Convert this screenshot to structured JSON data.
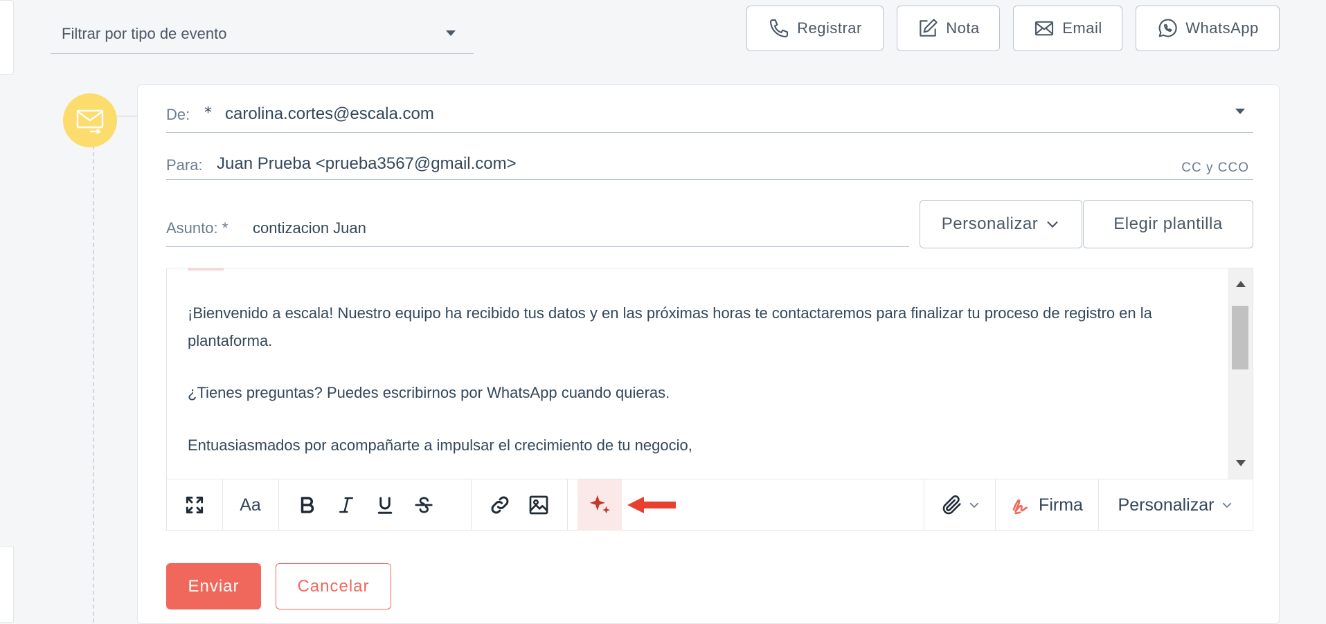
{
  "filter": {
    "label": "Filtrar por tipo de evento"
  },
  "actions": {
    "registrar": "Registrar",
    "nota": "Nota",
    "email": "Email",
    "whatsapp": "WhatsApp"
  },
  "email_form": {
    "from_label": "De:",
    "required_mark": "*",
    "from_value": "carolina.cortes@escala.com",
    "to_label": "Para:",
    "to_value": "Juan Prueba <prueba3567@gmail.com>",
    "cc_label": "CC y CCO",
    "subject_label": "Asunto: *",
    "subject_value": "contizacion Juan",
    "personalize_label": "Personalizar",
    "template_label": "Elegir plantilla"
  },
  "editor": {
    "paragraphs": [
      "¡Bienvenido a escala! Nuestro equipo ha recibido tus datos y en las próximas horas te contactaremos para finalizar tu proceso de registro en la plantaforma.",
      "¿Tienes preguntas? Puedes escribirnos por WhatsApp cuando quieras.",
      "Entuasiasmados por acompañarte a impulsar el crecimiento de tu negocio,"
    ],
    "toolbar": {
      "font_size": "Aa",
      "signature_label": "Firma",
      "personalize_label": "Personalizar"
    }
  },
  "buttons": {
    "send": "Enviar",
    "cancel": "Cancelar"
  },
  "colors": {
    "accent": "#f0685b",
    "ai_icon": "#c0392b",
    "timeline_dot": "#fddc6e",
    "border": "#b8c4d2"
  },
  "icons": {
    "timeline": "email-sent-icon",
    "ai": "sparkle-icon",
    "annotation": "red-arrow"
  }
}
